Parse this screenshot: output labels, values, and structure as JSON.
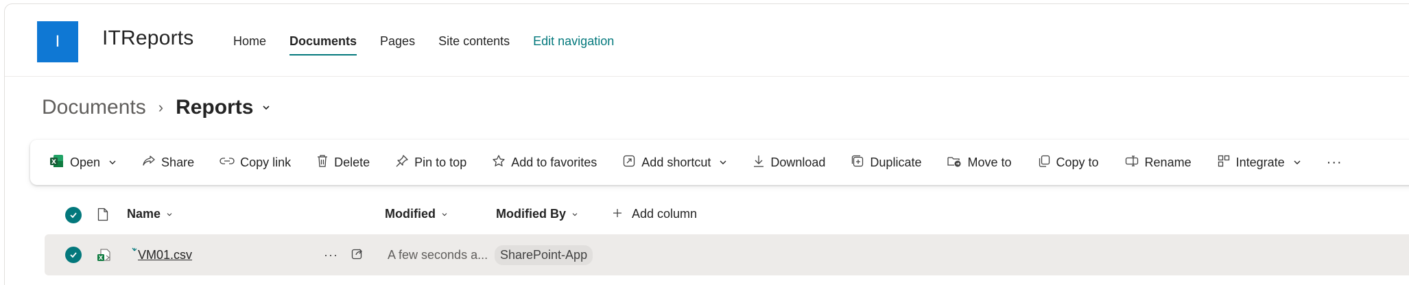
{
  "site": {
    "logo_letter": "I",
    "title": "ITReports"
  },
  "nav": {
    "items": [
      {
        "label": "Home"
      },
      {
        "label": "Documents"
      },
      {
        "label": "Pages"
      },
      {
        "label": "Site contents"
      }
    ],
    "edit_label": "Edit navigation"
  },
  "breadcrumb": {
    "root": "Documents",
    "separator": "›",
    "current": "Reports"
  },
  "command_bar": {
    "open": "Open",
    "share": "Share",
    "copy_link": "Copy link",
    "delete": "Delete",
    "pin_to_top": "Pin to top",
    "add_to_favorites": "Add to favorites",
    "add_shortcut": "Add shortcut",
    "download": "Download",
    "duplicate": "Duplicate",
    "move_to": "Move to",
    "copy_to": "Copy to",
    "rename": "Rename",
    "integrate": "Integrate",
    "more": "···"
  },
  "list": {
    "columns": {
      "name": "Name",
      "modified": "Modified",
      "modified_by": "Modified By",
      "add_column": "Add column"
    },
    "rows": [
      {
        "name": "VM01.csv",
        "modified": "A few seconds a...",
        "modified_by": "SharePoint-App",
        "more": "···"
      }
    ]
  },
  "colors": {
    "accent": "#03787c",
    "logo": "#0f78d4",
    "selected_row": "#edebe9",
    "excel_green": "#107c41"
  }
}
